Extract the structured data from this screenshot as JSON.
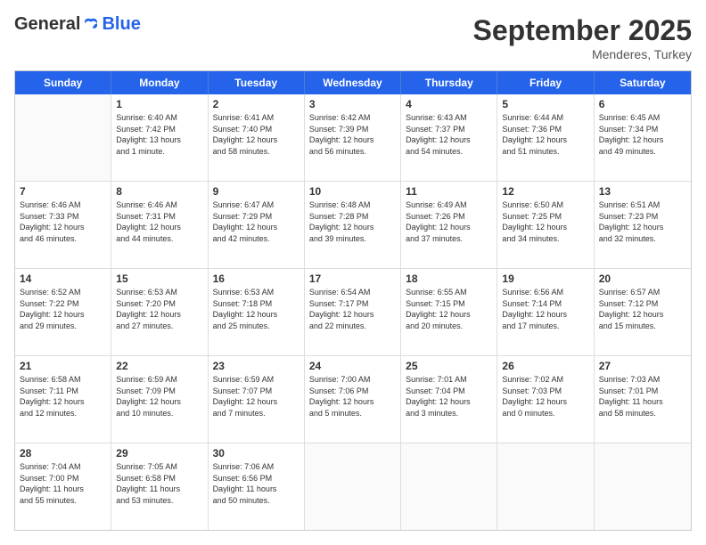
{
  "header": {
    "logo_general": "General",
    "logo_blue": "Blue",
    "month": "September 2025",
    "location": "Menderes, Turkey"
  },
  "days_of_week": [
    "Sunday",
    "Monday",
    "Tuesday",
    "Wednesday",
    "Thursday",
    "Friday",
    "Saturday"
  ],
  "weeks": [
    [
      {
        "day": "",
        "empty": true
      },
      {
        "day": "1",
        "line1": "Sunrise: 6:40 AM",
        "line2": "Sunset: 7:42 PM",
        "line3": "Daylight: 13 hours",
        "line4": "and 1 minute."
      },
      {
        "day": "2",
        "line1": "Sunrise: 6:41 AM",
        "line2": "Sunset: 7:40 PM",
        "line3": "Daylight: 12 hours",
        "line4": "and 58 minutes."
      },
      {
        "day": "3",
        "line1": "Sunrise: 6:42 AM",
        "line2": "Sunset: 7:39 PM",
        "line3": "Daylight: 12 hours",
        "line4": "and 56 minutes."
      },
      {
        "day": "4",
        "line1": "Sunrise: 6:43 AM",
        "line2": "Sunset: 7:37 PM",
        "line3": "Daylight: 12 hours",
        "line4": "and 54 minutes."
      },
      {
        "day": "5",
        "line1": "Sunrise: 6:44 AM",
        "line2": "Sunset: 7:36 PM",
        "line3": "Daylight: 12 hours",
        "line4": "and 51 minutes."
      },
      {
        "day": "6",
        "line1": "Sunrise: 6:45 AM",
        "line2": "Sunset: 7:34 PM",
        "line3": "Daylight: 12 hours",
        "line4": "and 49 minutes."
      }
    ],
    [
      {
        "day": "7",
        "line1": "Sunrise: 6:46 AM",
        "line2": "Sunset: 7:33 PM",
        "line3": "Daylight: 12 hours",
        "line4": "and 46 minutes."
      },
      {
        "day": "8",
        "line1": "Sunrise: 6:46 AM",
        "line2": "Sunset: 7:31 PM",
        "line3": "Daylight: 12 hours",
        "line4": "and 44 minutes."
      },
      {
        "day": "9",
        "line1": "Sunrise: 6:47 AM",
        "line2": "Sunset: 7:29 PM",
        "line3": "Daylight: 12 hours",
        "line4": "and 42 minutes."
      },
      {
        "day": "10",
        "line1": "Sunrise: 6:48 AM",
        "line2": "Sunset: 7:28 PM",
        "line3": "Daylight: 12 hours",
        "line4": "and 39 minutes."
      },
      {
        "day": "11",
        "line1": "Sunrise: 6:49 AM",
        "line2": "Sunset: 7:26 PM",
        "line3": "Daylight: 12 hours",
        "line4": "and 37 minutes."
      },
      {
        "day": "12",
        "line1": "Sunrise: 6:50 AM",
        "line2": "Sunset: 7:25 PM",
        "line3": "Daylight: 12 hours",
        "line4": "and 34 minutes."
      },
      {
        "day": "13",
        "line1": "Sunrise: 6:51 AM",
        "line2": "Sunset: 7:23 PM",
        "line3": "Daylight: 12 hours",
        "line4": "and 32 minutes."
      }
    ],
    [
      {
        "day": "14",
        "line1": "Sunrise: 6:52 AM",
        "line2": "Sunset: 7:22 PM",
        "line3": "Daylight: 12 hours",
        "line4": "and 29 minutes."
      },
      {
        "day": "15",
        "line1": "Sunrise: 6:53 AM",
        "line2": "Sunset: 7:20 PM",
        "line3": "Daylight: 12 hours",
        "line4": "and 27 minutes."
      },
      {
        "day": "16",
        "line1": "Sunrise: 6:53 AM",
        "line2": "Sunset: 7:18 PM",
        "line3": "Daylight: 12 hours",
        "line4": "and 25 minutes."
      },
      {
        "day": "17",
        "line1": "Sunrise: 6:54 AM",
        "line2": "Sunset: 7:17 PM",
        "line3": "Daylight: 12 hours",
        "line4": "and 22 minutes."
      },
      {
        "day": "18",
        "line1": "Sunrise: 6:55 AM",
        "line2": "Sunset: 7:15 PM",
        "line3": "Daylight: 12 hours",
        "line4": "and 20 minutes."
      },
      {
        "day": "19",
        "line1": "Sunrise: 6:56 AM",
        "line2": "Sunset: 7:14 PM",
        "line3": "Daylight: 12 hours",
        "line4": "and 17 minutes."
      },
      {
        "day": "20",
        "line1": "Sunrise: 6:57 AM",
        "line2": "Sunset: 7:12 PM",
        "line3": "Daylight: 12 hours",
        "line4": "and 15 minutes."
      }
    ],
    [
      {
        "day": "21",
        "line1": "Sunrise: 6:58 AM",
        "line2": "Sunset: 7:11 PM",
        "line3": "Daylight: 12 hours",
        "line4": "and 12 minutes."
      },
      {
        "day": "22",
        "line1": "Sunrise: 6:59 AM",
        "line2": "Sunset: 7:09 PM",
        "line3": "Daylight: 12 hours",
        "line4": "and 10 minutes."
      },
      {
        "day": "23",
        "line1": "Sunrise: 6:59 AM",
        "line2": "Sunset: 7:07 PM",
        "line3": "Daylight: 12 hours",
        "line4": "and 7 minutes."
      },
      {
        "day": "24",
        "line1": "Sunrise: 7:00 AM",
        "line2": "Sunset: 7:06 PM",
        "line3": "Daylight: 12 hours",
        "line4": "and 5 minutes."
      },
      {
        "day": "25",
        "line1": "Sunrise: 7:01 AM",
        "line2": "Sunset: 7:04 PM",
        "line3": "Daylight: 12 hours",
        "line4": "and 3 minutes."
      },
      {
        "day": "26",
        "line1": "Sunrise: 7:02 AM",
        "line2": "Sunset: 7:03 PM",
        "line3": "Daylight: 12 hours",
        "line4": "and 0 minutes."
      },
      {
        "day": "27",
        "line1": "Sunrise: 7:03 AM",
        "line2": "Sunset: 7:01 PM",
        "line3": "Daylight: 11 hours",
        "line4": "and 58 minutes."
      }
    ],
    [
      {
        "day": "28",
        "line1": "Sunrise: 7:04 AM",
        "line2": "Sunset: 7:00 PM",
        "line3": "Daylight: 11 hours",
        "line4": "and 55 minutes."
      },
      {
        "day": "29",
        "line1": "Sunrise: 7:05 AM",
        "line2": "Sunset: 6:58 PM",
        "line3": "Daylight: 11 hours",
        "line4": "and 53 minutes."
      },
      {
        "day": "30",
        "line1": "Sunrise: 7:06 AM",
        "line2": "Sunset: 6:56 PM",
        "line3": "Daylight: 11 hours",
        "line4": "and 50 minutes."
      },
      {
        "day": "",
        "empty": true
      },
      {
        "day": "",
        "empty": true
      },
      {
        "day": "",
        "empty": true
      },
      {
        "day": "",
        "empty": true
      }
    ]
  ]
}
